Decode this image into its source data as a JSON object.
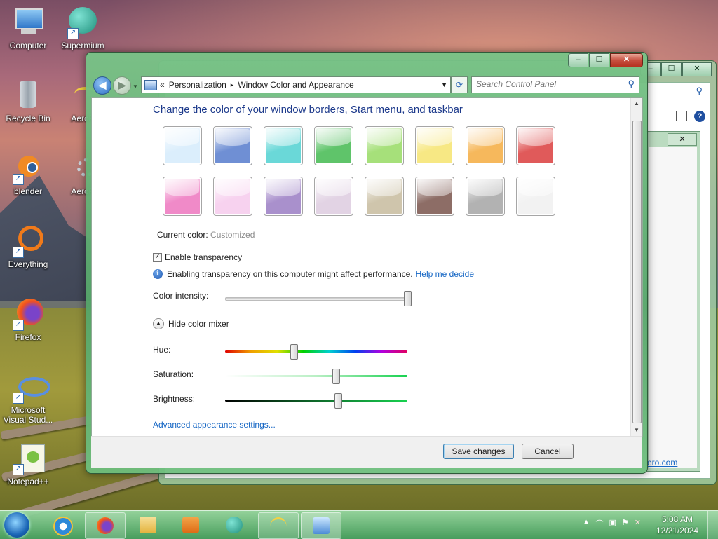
{
  "desktop": {
    "icons": [
      {
        "label": "Computer",
        "icon": "computer-icon"
      },
      {
        "label": "Supermium",
        "icon": "supermium-icon"
      },
      {
        "label": "Recycle Bin",
        "icon": "recycle-bin-icon"
      },
      {
        "label": "AeroRa",
        "icon": "aerorainbow-icon"
      },
      {
        "label": "blender",
        "icon": "blender-icon"
      },
      {
        "label": "AeroRa",
        "icon": "aerorainbow-settings-icon"
      },
      {
        "label": "Everything",
        "icon": "everything-icon"
      },
      {
        "label": "Firefox",
        "icon": "firefox-icon"
      },
      {
        "label": "Microsoft Visual Stud...",
        "icon": "visual-studio-icon"
      },
      {
        "label": "Notepad++",
        "icon": "notepadpp-icon"
      }
    ]
  },
  "background_window": {
    "link_fragment": "ero.com"
  },
  "window": {
    "caption_buttons": {
      "minimize": "–",
      "maximize": "☐",
      "close": "✕"
    },
    "breadcrumb": {
      "prefix": "«",
      "items": [
        "Personalization",
        "Window Color and Appearance"
      ],
      "separator": "▸"
    },
    "search": {
      "placeholder": "Search Control Panel"
    },
    "title": "Change the color of your window borders, Start menu, and taskbar",
    "swatches": [
      {
        "name": "sky",
        "color": "#dbeefc"
      },
      {
        "name": "twilight",
        "color": "#6f8fd4"
      },
      {
        "name": "sea",
        "color": "#6ad8d8"
      },
      {
        "name": "leaf",
        "color": "#5fc46a"
      },
      {
        "name": "lime",
        "color": "#a6e07a"
      },
      {
        "name": "lemon",
        "color": "#f7e884"
      },
      {
        "name": "orange",
        "color": "#f6b85c"
      },
      {
        "name": "ruby",
        "color": "#e05a5a"
      },
      {
        "name": "fuchsia",
        "color": "#f08ac8"
      },
      {
        "name": "blush",
        "color": "#f7d2ef"
      },
      {
        "name": "violet",
        "color": "#a990cc"
      },
      {
        "name": "lavender",
        "color": "#e2d3e4"
      },
      {
        "name": "taupe",
        "color": "#cfc5ac"
      },
      {
        "name": "chocolate",
        "color": "#8d6d66"
      },
      {
        "name": "slate",
        "color": "#b2b2b2"
      },
      {
        "name": "frost",
        "color": "#f2f2f2"
      }
    ],
    "current_color_label": "Current color:",
    "current_color_value": "Customized",
    "transparency_label": "Enable transparency",
    "transparency_checked": true,
    "perf_note": "Enabling transparency on this computer might affect performance.",
    "help_link": "Help me decide",
    "intensity_label": "Color intensity:",
    "intensity_value": 1.0,
    "mixer_toggle": "Hide color mixer",
    "hue_label": "Hue:",
    "hue_value": 0.38,
    "saturation_label": "Saturation:",
    "saturation_value": 0.61,
    "brightness_label": "Brightness:",
    "brightness_value": 0.62,
    "advanced_link": "Advanced appearance settings...",
    "save_button": "Save changes",
    "cancel_button": "Cancel"
  },
  "taskbar": {
    "items": [
      "internet-explorer-icon",
      "firefox-icon",
      "file-explorer-icon",
      "media-player-icon",
      "supermium-icon",
      "aerorainbow-icon",
      "control-panel-icon"
    ],
    "clock_time": "5:08 AM",
    "clock_date": "12/21/2024"
  }
}
